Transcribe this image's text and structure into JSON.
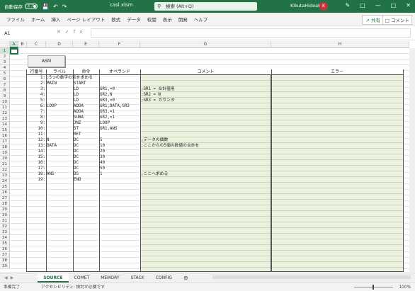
{
  "titlebar": {
    "autosave": "自動保存",
    "toggle": "オフ",
    "filename": "casl.xlsm",
    "search": "検索 (Alt+Q)",
    "user": "KikutaHideaki",
    "avatar": "K"
  },
  "menu": [
    "ファイル",
    "ホーム",
    "挿入",
    "ページ レイアウト",
    "数式",
    "データ",
    "校閲",
    "表示",
    "開発",
    "ヘルプ"
  ],
  "share_label": "共有",
  "comment_label": "コメント",
  "namebox": "A1",
  "columns": {
    "A": "A",
    "B": "B",
    "C": "C",
    "D": "D",
    "E": "E",
    "F": "F",
    "G": "G",
    "H": "H"
  },
  "rows": [
    "1",
    "2",
    "3",
    "4",
    "5",
    "6",
    "7",
    "8",
    "9",
    "10",
    "11",
    "12",
    "13",
    "14",
    "15",
    "16",
    "17",
    "18",
    "19",
    "20",
    "21",
    "22",
    "23",
    "24",
    "25",
    "26",
    "27",
    "28",
    "29",
    "30",
    "31",
    "32",
    "33",
    "34",
    "35",
    "36",
    "37",
    "38",
    "39"
  ],
  "asm_button": "ASM",
  "headers": {
    "lineno": "行番号",
    "label": "ラベル",
    "op": "命令",
    "operand": "オペランド",
    "comment": "コメント",
    "error": "エラー"
  },
  "lines": [
    {
      "n": "1:",
      "label": ";5つの数字の和を求める",
      "op": "",
      "operand": "",
      "comment": ""
    },
    {
      "n": "2:",
      "label": "MAIN",
      "op": "START",
      "operand": "",
      "comment": ""
    },
    {
      "n": "3:",
      "label": "",
      "op": "LD",
      "operand": "GR1,=0",
      "comment": ";GR1 = 合計値用"
    },
    {
      "n": "4:",
      "label": "",
      "op": "LD",
      "operand": "GR2,N",
      "comment": ";GR2 = N"
    },
    {
      "n": "5:",
      "label": "",
      "op": "LD",
      "operand": "GR3,=0",
      "comment": ";GR3 = カウンタ"
    },
    {
      "n": "6:",
      "label": "LOOP",
      "op": "ADDA",
      "operand": "GR1,DATA,GR3",
      "comment": ""
    },
    {
      "n": "7:",
      "label": "",
      "op": "ADDA",
      "operand": "GR3,=1",
      "comment": ""
    },
    {
      "n": "8:",
      "label": "",
      "op": "SUBA",
      "operand": "GR2,=1",
      "comment": ""
    },
    {
      "n": "9:",
      "label": "",
      "op": "JNZ",
      "operand": "LOOP",
      "comment": ""
    },
    {
      "n": "10:",
      "label": "",
      "op": "ST",
      "operand": "GR1,ANS",
      "comment": ""
    },
    {
      "n": "11:",
      "label": "",
      "op": "RET",
      "operand": "",
      "comment": ""
    },
    {
      "n": "12:",
      "label": "N",
      "op": "DC",
      "operand": "5",
      "comment": ";データの個数"
    },
    {
      "n": "13:",
      "label": "DATA",
      "op": "DC",
      "operand": "10",
      "comment": ";ここからの5個の数値の合計を"
    },
    {
      "n": "14:",
      "label": "",
      "op": "DC",
      "operand": "20",
      "comment": ""
    },
    {
      "n": "15:",
      "label": "",
      "op": "DC",
      "operand": "30",
      "comment": ""
    },
    {
      "n": "16:",
      "label": "",
      "op": "DC",
      "operand": "40",
      "comment": ""
    },
    {
      "n": "17:",
      "label": "",
      "op": "DC",
      "operand": "50",
      "comment": ""
    },
    {
      "n": "18:",
      "label": "ANS",
      "op": "DS",
      "operand": "1",
      "comment": ";ここへ求める"
    },
    {
      "n": "19:",
      "label": "",
      "op": "END",
      "operand": "",
      "comment": ""
    }
  ],
  "tabs": [
    "SOURCE",
    "COMET",
    "MEMORY",
    "STACK",
    "CONFIG"
  ],
  "active_tab": "SOURCE",
  "status": {
    "ready": "準備完了",
    "accessibility": "アクセシビリティ: 検討が必要です",
    "zoom": "100%"
  }
}
